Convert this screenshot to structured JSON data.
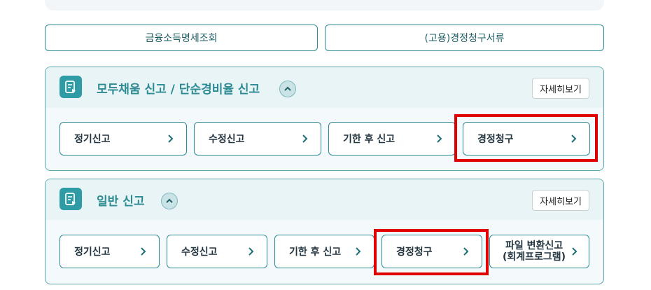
{
  "top_buttons": {
    "financial_income": "금융소득명세조회",
    "employment_claim": "(고용)경정청구서류"
  },
  "panels": [
    {
      "title": "모두채움 신고 / 단순경비율 신고",
      "detail_label": "자세히보기",
      "options": [
        "정기신고",
        "수정신고",
        "기한 후 신고",
        "경정청구"
      ]
    },
    {
      "title": "일반 신고",
      "detail_label": "자세히보기",
      "options": [
        "정기신고",
        "수정신고",
        "기한 후 신고",
        "경정청구"
      ],
      "file_convert_line1": "파일 변환신고",
      "file_convert_line2": "(회계프로그램)"
    }
  ],
  "colors": {
    "accent": "#2e8b93",
    "border": "#2d8a93",
    "highlight": "#e00000"
  },
  "icons": [
    "document-icon",
    "chevron-up-icon",
    "chevron-right-icon"
  ]
}
